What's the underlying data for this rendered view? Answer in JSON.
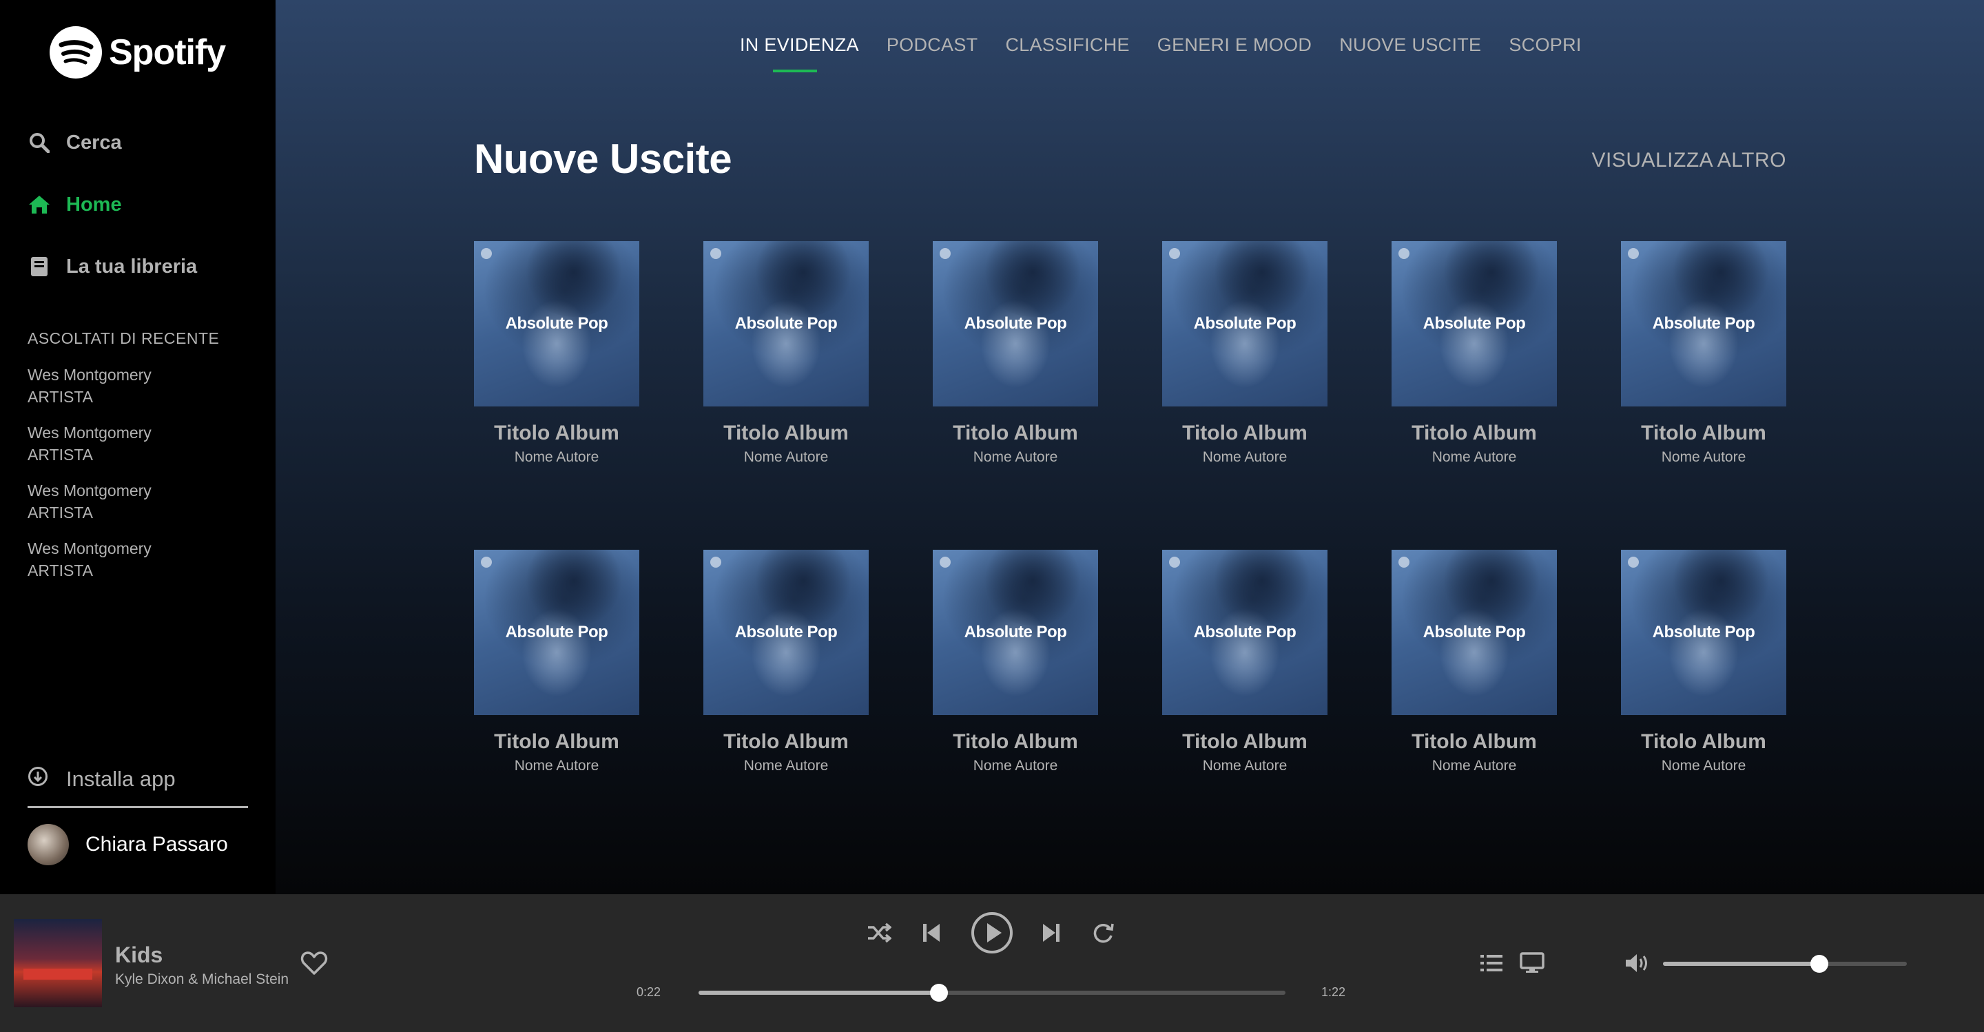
{
  "app": {
    "logo_text": "Spotify"
  },
  "sidebar": {
    "nav": [
      {
        "label": "Cerca",
        "icon": "search-icon",
        "active": false
      },
      {
        "label": "Home",
        "icon": "home-icon",
        "active": true
      },
      {
        "label": "La tua libreria",
        "icon": "library-icon",
        "active": false
      }
    ],
    "recent_title": "ASCOLTATI DI RECENTE",
    "recent": [
      {
        "name": "Wes Montgomery",
        "type": "ARTISTA"
      },
      {
        "name": "Wes Montgomery",
        "type": "ARTISTA"
      },
      {
        "name": "Wes Montgomery",
        "type": "ARTISTA"
      },
      {
        "name": "Wes Montgomery",
        "type": "ARTISTA"
      }
    ],
    "install_label": "Installa app",
    "user_name": "Chiara Passaro"
  },
  "header": {
    "tabs": [
      {
        "label": "IN EVIDENZA",
        "active": true
      },
      {
        "label": "PODCAST",
        "active": false
      },
      {
        "label": "CLASSIFICHE",
        "active": false
      },
      {
        "label": "GENERI E MOOD",
        "active": false
      },
      {
        "label": "NUOVE USCITE",
        "active": false
      },
      {
        "label": "SCOPRI",
        "active": false
      }
    ]
  },
  "main": {
    "section_title": "Nuove Uscite",
    "see_more": "VISUALIZZA ALTRO",
    "albums": [
      {
        "cover_text": "Absolute Pop",
        "title": "Titolo Album",
        "author": "Nome Autore"
      },
      {
        "cover_text": "Absolute Pop",
        "title": "Titolo Album",
        "author": "Nome Autore"
      },
      {
        "cover_text": "Absolute Pop",
        "title": "Titolo Album",
        "author": "Nome Autore"
      },
      {
        "cover_text": "Absolute Pop",
        "title": "Titolo Album",
        "author": "Nome Autore"
      },
      {
        "cover_text": "Absolute Pop",
        "title": "Titolo Album",
        "author": "Nome Autore"
      },
      {
        "cover_text": "Absolute Pop",
        "title": "Titolo Album",
        "author": "Nome Autore"
      },
      {
        "cover_text": "Absolute Pop",
        "title": "Titolo Album",
        "author": "Nome Autore"
      },
      {
        "cover_text": "Absolute Pop",
        "title": "Titolo Album",
        "author": "Nome Autore"
      },
      {
        "cover_text": "Absolute Pop",
        "title": "Titolo Album",
        "author": "Nome Autore"
      },
      {
        "cover_text": "Absolute Pop",
        "title": "Titolo Album",
        "author": "Nome Autore"
      },
      {
        "cover_text": "Absolute Pop",
        "title": "Titolo Album",
        "author": "Nome Autore"
      },
      {
        "cover_text": "Absolute Pop",
        "title": "Titolo Album",
        "author": "Nome Autore"
      }
    ]
  },
  "player": {
    "track_title": "Kids",
    "track_artist": "Kyle Dixon & Michael Stein",
    "time_current": "0:22",
    "time_total": "1:22",
    "progress_fraction": 0.41,
    "volume_fraction": 0.64
  },
  "colors": {
    "accent": "#1db954",
    "muted_text": "#b3b3b3",
    "player_bg": "#282828"
  }
}
